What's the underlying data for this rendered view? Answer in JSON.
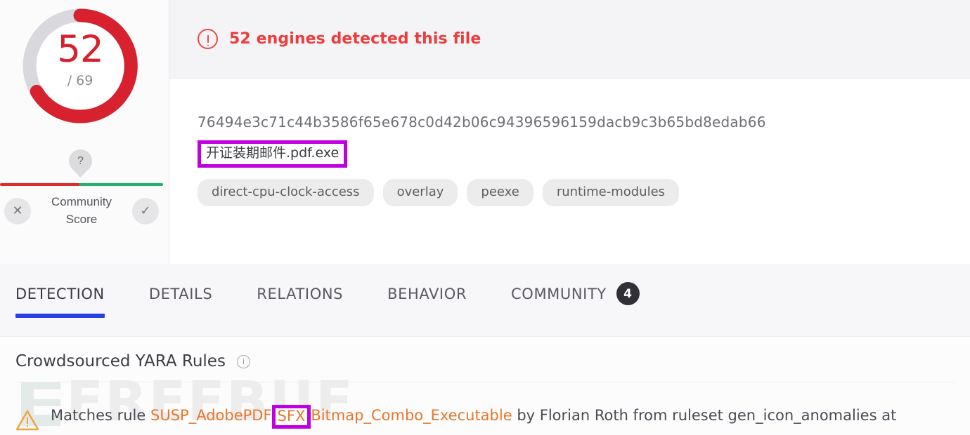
{
  "gauge": {
    "score": "52",
    "total": "/ 69",
    "detected": 52,
    "engines": 69,
    "arc_color": "#d7212f",
    "track_color": "#d9d9dd"
  },
  "community": {
    "pin_label": "?",
    "label": "Community Score",
    "negative_icon": "✕",
    "positive_icon": "✓",
    "bar_negative_color": "#e02b2b",
    "bar_positive_color": "#23b26a"
  },
  "detection_banner": {
    "icon": "alert-circle-icon",
    "text": "52 engines detected this file",
    "color": "#ee3c3c"
  },
  "file": {
    "hash": "76494e3c71c44b3586f65e678c0d42b06c94396596159dacb9c3b65bd8edab66",
    "name": "开证装期邮件.pdf.exe",
    "highlight_color": "#c000e0",
    "tags": [
      "direct-cpu-clock-access",
      "overlay",
      "peexe",
      "runtime-modules"
    ]
  },
  "tabs": [
    {
      "label": "DETECTION",
      "active": true,
      "badge": ""
    },
    {
      "label": "DETAILS",
      "active": false,
      "badge": ""
    },
    {
      "label": "RELATIONS",
      "active": false,
      "badge": ""
    },
    {
      "label": "BEHAVIOR",
      "active": false,
      "badge": ""
    },
    {
      "label": "COMMUNITY",
      "active": false,
      "badge": "4"
    }
  ],
  "tab_accent_color": "#2640e0",
  "yara": {
    "title": "Crowdsourced YARA Rules",
    "info_icon": "i",
    "match": {
      "prefix": "Matches rule ",
      "rule_part1": "SUSP_AdobePDF",
      "rule_highlight": "SFX",
      "rule_part2": "Bitmap_Combo_Executable",
      "suffix": " by Florian Roth from ruleset gen_icon_anomalies at",
      "rule_color": "#e8762a"
    }
  },
  "watermark": {
    "text": "FREEBUF"
  }
}
